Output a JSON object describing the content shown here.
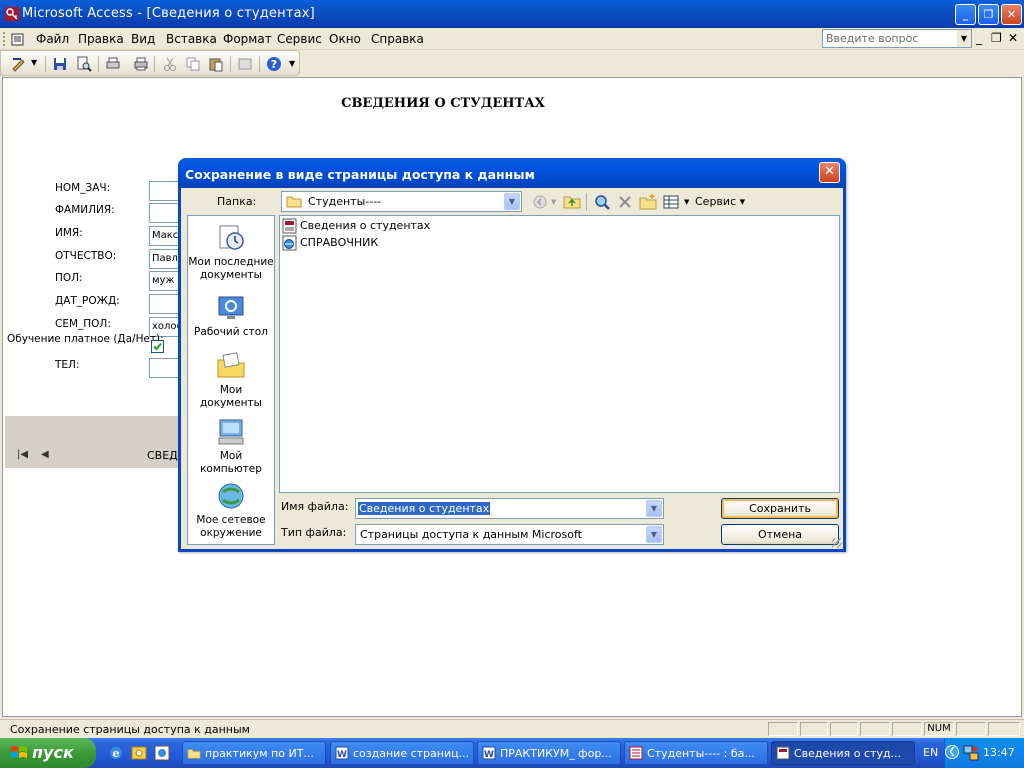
{
  "window": {
    "title": "Microsoft Access - [Сведения о студентах]"
  },
  "menu": {
    "items": [
      "Файл",
      "Правка",
      "Вид",
      "Вставка",
      "Формат",
      "Сервис",
      "Окно",
      "Справка"
    ],
    "ask_placeholder": "Введите вопрос"
  },
  "form": {
    "title": "СВЕДЕНИЯ О СТУДЕНТАХ",
    "fields": [
      {
        "label": "НОМ_ЗАЧ:",
        "value": ""
      },
      {
        "label": "ФАМИЛИЯ:",
        "value": ""
      },
      {
        "label": "ИМЯ:",
        "value": "Макси"
      },
      {
        "label": "ОТЧЕСТВО:",
        "value": "Павло"
      },
      {
        "label": "ПОЛ:",
        "value": "муж"
      },
      {
        "label": "ДАТ_РОЖД:",
        "value": ""
      },
      {
        "label": "СЕМ_ПОЛ:",
        "value": "холос"
      }
    ],
    "paid_label": "Обучение платное (Да/Нет):",
    "tel_label": "ТЕЛ:",
    "nav_label": "СВЕДЕ"
  },
  "dialog": {
    "title": "Сохранение в виде страницы доступа к данным",
    "folder_label": "Папка:",
    "folder_value": "Студенты----",
    "service_label": "Сервис",
    "places": [
      {
        "label": "Мои последние документы",
        "icon": "recent-documents-icon"
      },
      {
        "label": "Рабочий стол",
        "icon": "desktop-icon"
      },
      {
        "label": "Мои документы",
        "icon": "my-documents-icon"
      },
      {
        "label": "Мой компьютер",
        "icon": "my-computer-icon"
      },
      {
        "label": "Мое сетевое окружение",
        "icon": "network-places-icon"
      }
    ],
    "files": [
      {
        "name": "Сведения о студентах",
        "icon": "data-access-page-icon"
      },
      {
        "name": "СПРАВОЧНИК",
        "icon": "web-page-icon"
      }
    ],
    "filename_label": "Имя файла:",
    "filename_value": "Сведения о студентах",
    "filetype_label": "Тип файла:",
    "filetype_value": "Страницы доступа к данным Microsoft",
    "save_label": "Сохранить",
    "cancel_label": "Отмена"
  },
  "status": {
    "text": "Сохранение страницы доступа к данным",
    "num": "NUM"
  },
  "taskbar": {
    "start_label": "пуск",
    "tasks": [
      "практикум по ИТ...",
      "создание страниц...",
      "ПРАКТИКУМ_ фор...",
      "Студенты---- : ба...",
      "Сведения о студ..."
    ],
    "lang": "EN",
    "clock": "13:47"
  }
}
